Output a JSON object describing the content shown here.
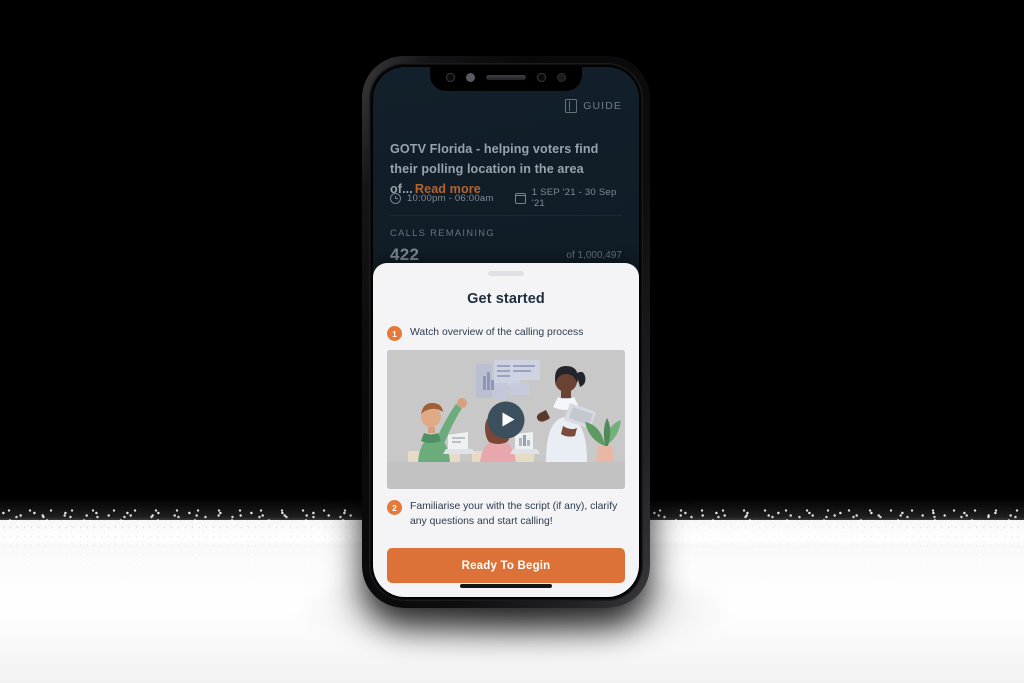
{
  "app": {
    "guide_button": "GUIDE",
    "guide_icon": "book-icon",
    "campaign_title": "GOTV Florida - helping voters find their polling location in  the area of...",
    "read_more": "Read more",
    "schedule_time": "10:00pm - 06:00am",
    "schedule_time_icon": "clock-icon",
    "schedule_dates": "1 SEP '21 - 30 Sep '21",
    "schedule_dates_icon": "calendar-icon",
    "calls_remaining_label": "CALLS REMAINING",
    "calls_remaining_value": "422",
    "calls_total": "of 1,000,497"
  },
  "sheet": {
    "title": "Get started",
    "steps": [
      {
        "number": "1",
        "text": "Watch overview of the calling process"
      },
      {
        "number": "2",
        "text": "Familiarise your with the script (if any), clarify any questions and start calling!"
      }
    ],
    "video": {
      "play_icon": "play-icon",
      "alt": "Illustration of three colleagues in an office with laptops and charts"
    },
    "primary_button": "Ready To Begin"
  },
  "colors": {
    "accent_orange": "#dd7238",
    "badge_orange": "#e4793a",
    "read_more_orange": "#b5632f",
    "header_dark": "#101c26",
    "sheet_bg": "#f4f4f6",
    "text_dark": "#1f2d3d",
    "play_circle": "#3b4f5c"
  }
}
